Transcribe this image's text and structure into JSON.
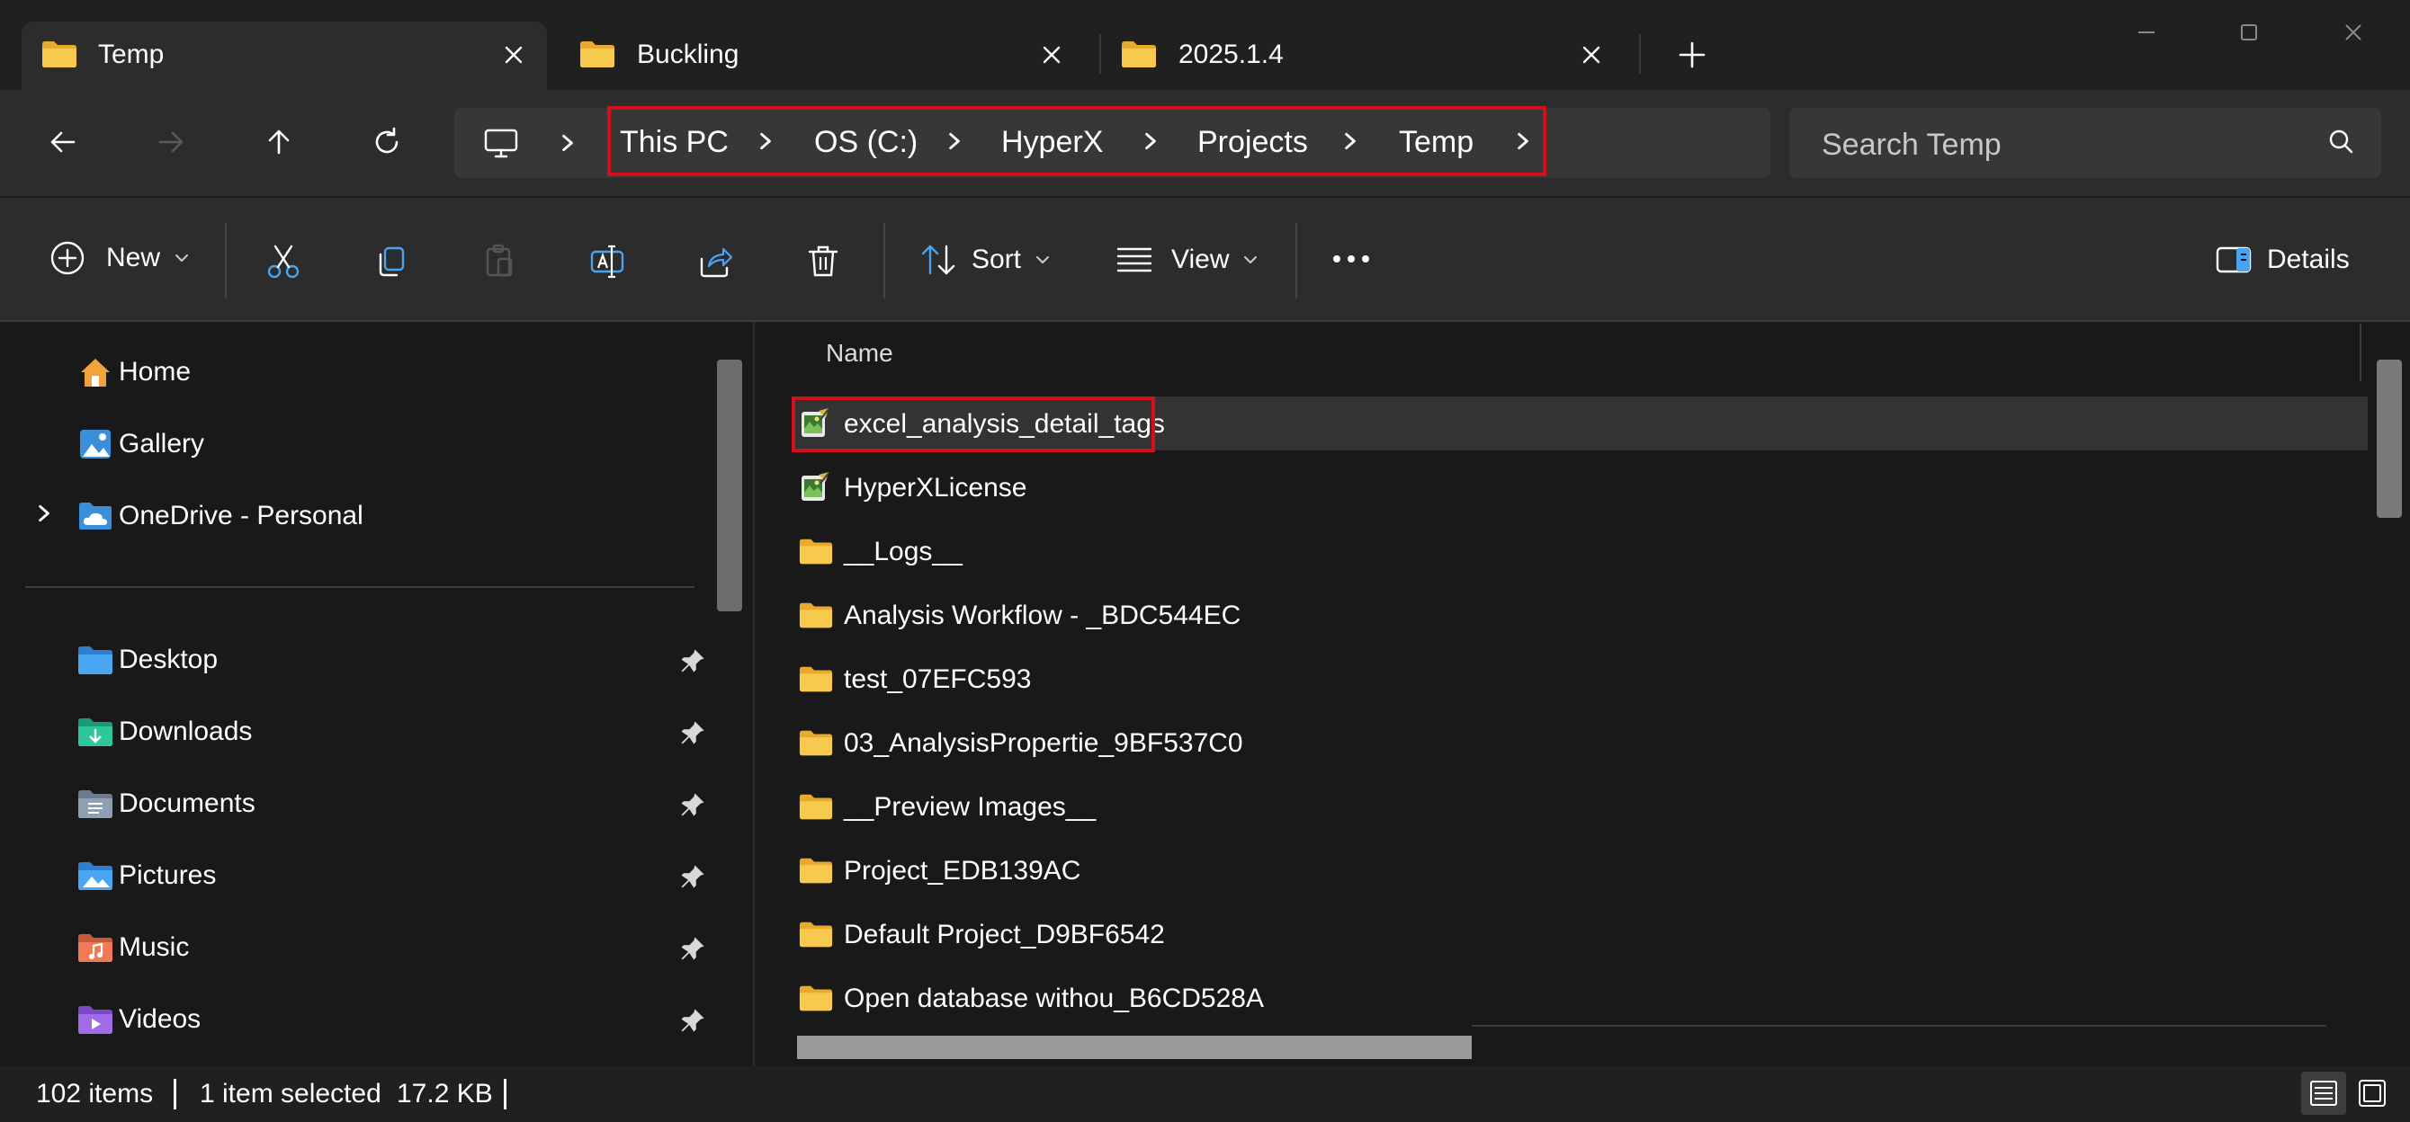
{
  "tabs": [
    {
      "label": "Temp"
    },
    {
      "label": "Buckling"
    },
    {
      "label": "2025.1.4"
    }
  ],
  "address": {
    "crumbs": [
      "This PC",
      "OS (C:)",
      "HyperX",
      "Projects",
      "Temp"
    ]
  },
  "search": {
    "placeholder": "Search Temp"
  },
  "toolbar": {
    "new_label": "New",
    "sort_label": "Sort",
    "view_label": "View",
    "details_label": "Details"
  },
  "sidebar": {
    "top": [
      {
        "label": "Home",
        "icon": "home-icon"
      },
      {
        "label": "Gallery",
        "icon": "gallery-icon"
      },
      {
        "label": "OneDrive - Personal",
        "icon": "onedrive-icon"
      }
    ],
    "pinned": [
      {
        "label": "Desktop",
        "icon": "desktop-folder-icon"
      },
      {
        "label": "Downloads",
        "icon": "downloads-folder-icon"
      },
      {
        "label": "Documents",
        "icon": "documents-folder-icon"
      },
      {
        "label": "Pictures",
        "icon": "pictures-folder-icon"
      },
      {
        "label": "Music",
        "icon": "music-folder-icon"
      },
      {
        "label": "Videos",
        "icon": "videos-folder-icon"
      }
    ]
  },
  "files": {
    "column_name": "Name",
    "rows": [
      {
        "name": "excel_analysis_detail_tags",
        "type": "file",
        "selected": true
      },
      {
        "name": "HyperXLicense",
        "type": "file"
      },
      {
        "name": "__Logs__",
        "type": "folder"
      },
      {
        "name": "Analysis Workflow - _BDC544EC",
        "type": "folder"
      },
      {
        "name": "test_07EFC593",
        "type": "folder"
      },
      {
        "name": "03_AnalysisPropertie_9BF537C0",
        "type": "folder"
      },
      {
        "name": "__Preview Images__",
        "type": "folder"
      },
      {
        "name": "Project_EDB139AC",
        "type": "folder"
      },
      {
        "name": "Default Project_D9BF6542",
        "type": "folder"
      },
      {
        "name": "Open database withou_B6CD528A",
        "type": "folder"
      }
    ]
  },
  "status": {
    "item_count": "102 items",
    "selection": "1 item selected",
    "size": "17.2 KB"
  },
  "colors": {
    "highlight": "#d0101a",
    "folder": "#f2c04e",
    "background": "#191919"
  }
}
